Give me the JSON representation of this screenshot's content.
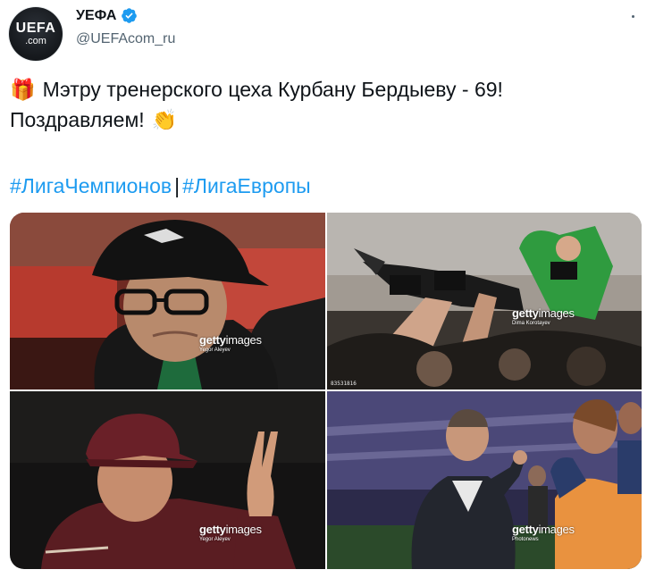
{
  "account": {
    "avatar_line1": "UEFA",
    "avatar_line2": ".com",
    "name": "УЕФА",
    "handle": "@UEFAcom_ru",
    "verified": true
  },
  "menu": {
    "icon": "more-horizontal-icon"
  },
  "tweet": {
    "line1_emoji": "🎁",
    "line1": "Мэтру тренерского цеха Курбану Бердыеву - 69!",
    "line2": "Поздравляем!",
    "line2_emoji": "👏",
    "hashtag1": "#ЛигаЧемпионов",
    "separator": "|",
    "hashtag2": "#ЛигаЕвропы"
  },
  "photos": [
    {
      "watermark_brand": "getty",
      "watermark_suffix": "images",
      "credit": "Yegor Aleyev",
      "code": ""
    },
    {
      "watermark_brand": "getty",
      "watermark_suffix": "images",
      "credit": "Dima Korotayev",
      "code": "83531816"
    },
    {
      "watermark_brand": "getty",
      "watermark_suffix": "images",
      "credit": "Yegor Aleyev",
      "code": ""
    },
    {
      "watermark_brand": "getty",
      "watermark_suffix": "images",
      "credit": "Photonews",
      "code": ""
    }
  ],
  "colors": {
    "link": "#1d9bf0",
    "verified": "#1d9bf0",
    "text": "#0f1419",
    "secondary": "#536471"
  }
}
